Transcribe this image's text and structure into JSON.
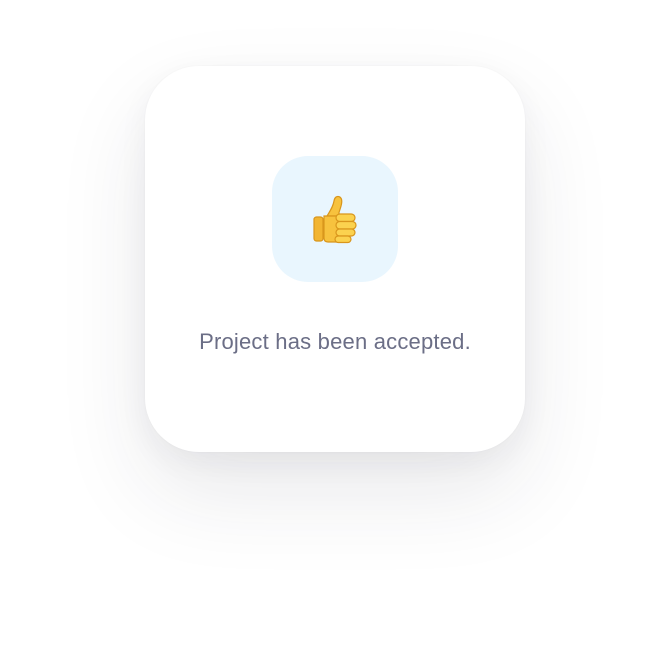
{
  "dialog": {
    "icon": "thumbs-up-icon",
    "message": "Project has been accepted.",
    "icon_tile_color": "#e9f6fe",
    "message_color": "#6b6e86"
  }
}
